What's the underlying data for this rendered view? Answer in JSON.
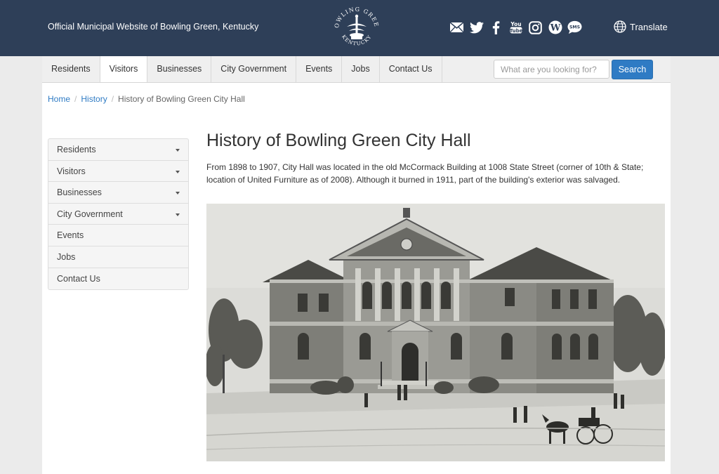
{
  "header": {
    "site_title": "Official Municipal Website of Bowling Green, Kentucky",
    "logo_text_top": "BOWLING GREEN",
    "logo_text_bottom": "KENTUCKY",
    "social_icons": [
      "mail-icon",
      "twitter-icon",
      "facebook-icon",
      "youtube-icon",
      "instagram-icon",
      "wordpress-icon",
      "sms-icon"
    ],
    "sms_label": "SMS",
    "youtube_label": "You Tube",
    "translate_label": "Translate",
    "colors": {
      "background": "#2e3f58",
      "text": "#ffffff"
    }
  },
  "nav": {
    "items": [
      "Residents",
      "Visitors",
      "Businesses",
      "City Government",
      "Events",
      "Jobs",
      "Contact Us"
    ],
    "active": "Visitors",
    "search_placeholder": "What are you looking for?",
    "search_value": "",
    "search_button": "Search",
    "accent": "#2f7bc4"
  },
  "breadcrumb": {
    "home": "Home",
    "history": "History",
    "current": "History of Bowling Green City Hall",
    "separator": "/"
  },
  "sidebar": {
    "items": [
      {
        "label": "Residents",
        "has_dropdown": true
      },
      {
        "label": "Visitors",
        "has_dropdown": true
      },
      {
        "label": "Businesses",
        "has_dropdown": true
      },
      {
        "label": "City Government",
        "has_dropdown": true
      },
      {
        "label": "Events",
        "has_dropdown": false
      },
      {
        "label": "Jobs",
        "has_dropdown": false
      },
      {
        "label": "Contact Us",
        "has_dropdown": false
      }
    ]
  },
  "main": {
    "title": "History of Bowling Green City Hall",
    "intro": "From 1898 to 1907, City Hall was located in the old McCormack Building at 1008 State Street (corner of 10th & State; location of United Furniture as of 2008). Although it burned in 1911, part of the building's exterior was salvaged."
  }
}
